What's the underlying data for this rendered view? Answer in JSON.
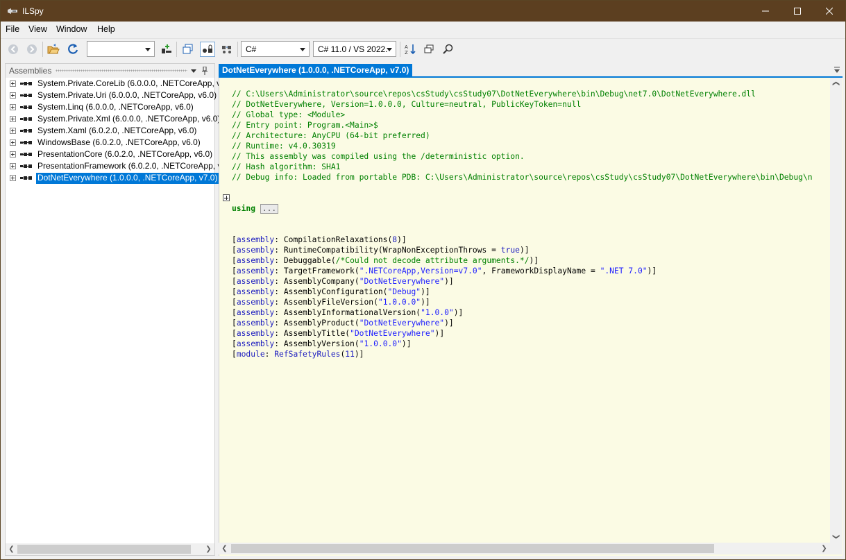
{
  "window": {
    "title": "ILSpy",
    "title_bar_color": "#5c3f20"
  },
  "menu": [
    "File",
    "View",
    "Window",
    "Help"
  ],
  "toolbar": {
    "back_icon": "back-arrow-icon",
    "forward_icon": "forward-arrow-icon",
    "open_icon": "open-folder-icon",
    "refresh_icon": "refresh-icon",
    "assembly_list_value": "",
    "language_value": "C#",
    "language_version_value": "C# 11.0 / VS 2022.",
    "accent": "#0078d7"
  },
  "assemblies_pane": {
    "header": "Assemblies",
    "items": [
      "System.Private.CoreLib (6.0.0.0, .NETCoreApp, v6",
      "System.Private.Uri (6.0.0.0, .NETCoreApp, v6.0)",
      "System.Linq (6.0.0.0, .NETCoreApp, v6.0)",
      "System.Private.Xml (6.0.0.0, .NETCoreApp, v6.0)",
      "System.Xaml (6.0.2.0, .NETCoreApp, v6.0)",
      "WindowsBase (6.0.2.0, .NETCoreApp, v6.0)",
      "PresentationCore (6.0.2.0, .NETCoreApp, v6.0)",
      "PresentationFramework (6.0.2.0, .NETCoreApp, v",
      "DotNetEverywhere (1.0.0.0, .NETCoreApp, v7.0)"
    ],
    "selected_index": 8
  },
  "document_tab": {
    "title": "DotNetEverywhere (1.0.0.0, .NETCoreApp, v7.0)"
  },
  "code": {
    "header_comments": [
      "// C:\\Users\\Administrator\\source\\repos\\csStudy\\csStudy07\\DotNetEverywhere\\bin\\Debug\\net7.0\\DotNetEverywhere.dll",
      "// DotNetEverywhere, Version=1.0.0.0, Culture=neutral, PublicKeyToken=null",
      "// Global type: <Module>",
      "// Entry point: Program.<Main>$",
      "// Architecture: AnyCPU (64-bit preferred)",
      "// Runtime: v4.0.30319",
      "// This assembly was compiled using the /deterministic option.",
      "// Hash algorithm: SHA1",
      "// Debug info: Loaded from portable PDB: C:\\Users\\Administrator\\source\\repos\\csStudy\\csStudy07\\DotNetEverywhere\\bin\\Debug\\n"
    ],
    "using_keyword": "using",
    "using_collapsed": "...",
    "attributes": [
      {
        "target": "assembly",
        "name": "CompilationRelaxations",
        "pre": "(",
        "arg": "8",
        "post": ")]",
        "arg_kind": "num"
      },
      {
        "target": "assembly",
        "name": "RuntimeCompatibility",
        "pre": "(WrapNonExceptionThrows = ",
        "arg": "true",
        "post": ")]",
        "arg_kind": "kw"
      },
      {
        "target": "assembly",
        "name": "Debuggable",
        "pre": "(",
        "arg": "/*Could not decode attribute arguments.*/",
        "post": ")]",
        "arg_kind": "com"
      },
      {
        "target": "assembly",
        "name": "TargetFramework",
        "pre": "(",
        "arg": "\".NETCoreApp,Version=v7.0\"",
        "post": ", FrameworkDisplayName = ",
        "arg2": "\".NET 7.0\"",
        "post2": ")]",
        "arg_kind": "str"
      },
      {
        "target": "assembly",
        "name": "AssemblyCompany",
        "pre": "(",
        "arg": "\"DotNetEverywhere\"",
        "post": ")]",
        "arg_kind": "str"
      },
      {
        "target": "assembly",
        "name": "AssemblyConfiguration",
        "pre": "(",
        "arg": "\"Debug\"",
        "post": ")]",
        "arg_kind": "str"
      },
      {
        "target": "assembly",
        "name": "AssemblyFileVersion",
        "pre": "(",
        "arg": "\"1.0.0.0\"",
        "post": ")]",
        "arg_kind": "str"
      },
      {
        "target": "assembly",
        "name": "AssemblyInformationalVersion",
        "pre": "(",
        "arg": "\"1.0.0\"",
        "post": ")]",
        "arg_kind": "str"
      },
      {
        "target": "assembly",
        "name": "AssemblyProduct",
        "pre": "(",
        "arg": "\"DotNetEverywhere\"",
        "post": ")]",
        "arg_kind": "str"
      },
      {
        "target": "assembly",
        "name": "AssemblyTitle",
        "pre": "(",
        "arg": "\"DotNetEverywhere\"",
        "post": ")]",
        "arg_kind": "str"
      },
      {
        "target": "assembly",
        "name": "AssemblyVersion",
        "pre": "(",
        "arg": "\"1.0.0.0\"",
        "post": ")]",
        "arg_kind": "str"
      },
      {
        "target": "module",
        "name": "RefSafetyRules",
        "pre": "(",
        "arg": "11",
        "post": ")]",
        "arg_kind": "num",
        "name_colored": true
      }
    ]
  }
}
